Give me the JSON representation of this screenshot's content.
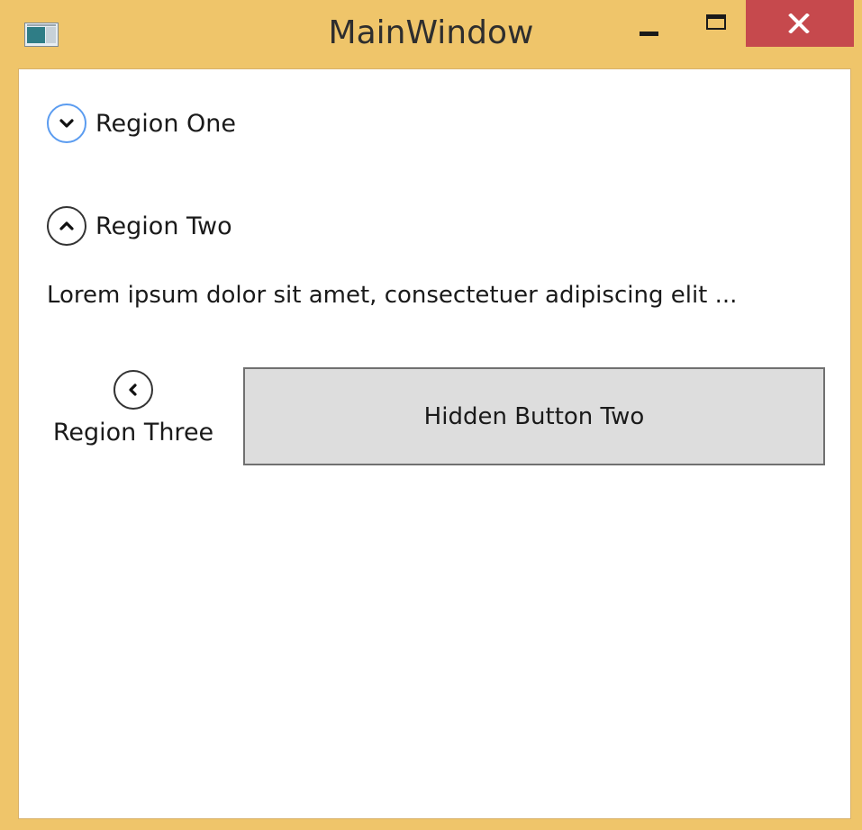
{
  "window": {
    "title": "MainWindow",
    "frame_color": "#efc56a",
    "close_color": "#c6494d"
  },
  "icons": {
    "app": "app-window-icon",
    "minimize": "minimize-icon",
    "maximize": "maximize-icon",
    "close": "close-icon",
    "expand_down": "chevron-down-icon",
    "collapse_up": "chevron-up-icon",
    "collapse_left": "chevron-left-icon"
  },
  "regions": {
    "one": {
      "label": "Region One",
      "expanded": false,
      "focused": true
    },
    "two": {
      "label": "Region Two",
      "expanded": true,
      "content": "Lorem ipsum dolor sit amet, consectetuer adipiscing elit ..."
    },
    "three": {
      "label": "Region Three",
      "expanded": true,
      "button_label": "Hidden Button Two"
    }
  }
}
